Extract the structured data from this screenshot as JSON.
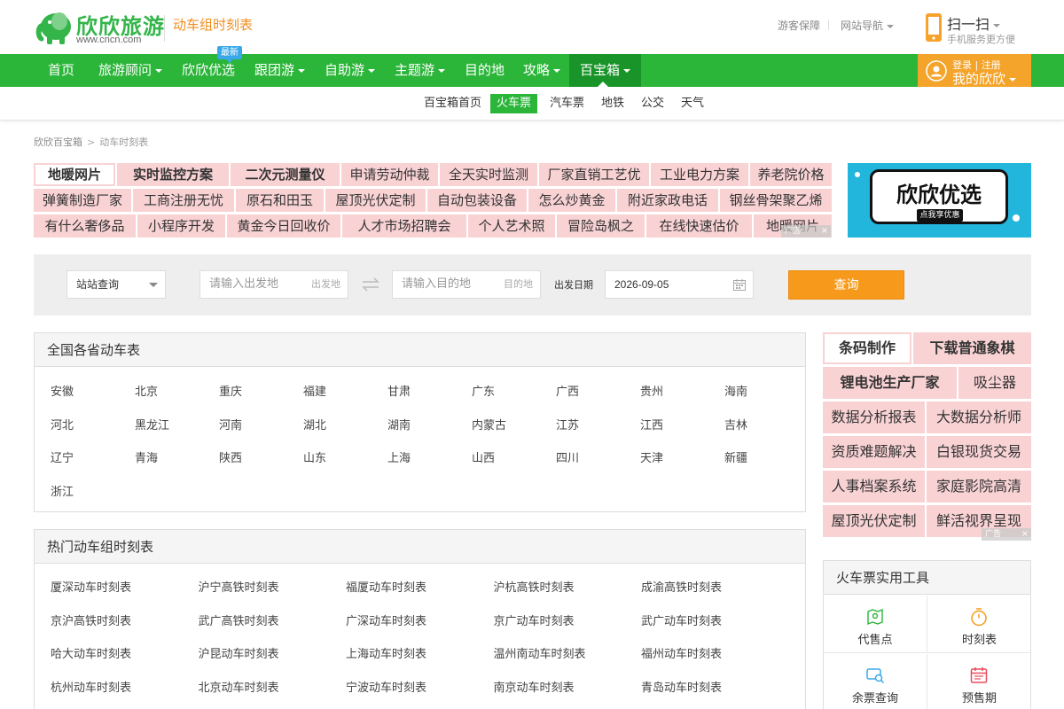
{
  "header": {
    "logo_text": "欣欣旅游",
    "logo_url": "www.cncn.com",
    "page_subtitle": "动车组时刻表",
    "top_links": {
      "guarantee": "游客保障",
      "site_nav": "网站导航"
    },
    "scan": {
      "title": "扫一扫",
      "subtitle": "手机服务更方便"
    }
  },
  "nav": {
    "items": [
      "首页",
      "旅游顾问",
      "欣欣优选",
      "跟团游",
      "自助游",
      "主题游",
      "目的地",
      "攻略",
      "百宝箱"
    ],
    "new_badge": "最新",
    "login": "登录",
    "register": "注册",
    "my_title": "我的欣欣"
  },
  "subnav": {
    "items": [
      "百宝箱首页",
      "火车票",
      "汽车票",
      "地铁",
      "公交",
      "天气"
    ]
  },
  "breadcrumb": {
    "home": "欣欣百宝箱",
    "current": "动车时刻表"
  },
  "ads": {
    "row1": [
      "地暖网片",
      "实时监控方案",
      "二次元测量仪",
      "申请劳动仲裁",
      "全天实时监测",
      "厂家直销工艺优",
      "工业电力方案",
      "养老院价格"
    ],
    "row2": [
      "弹簧制造厂家",
      "工商注册无忧",
      "原石和田玉",
      "屋顶光伏定制",
      "自动包装设备",
      "怎么炒黄金",
      "附近家政电话",
      "钢丝骨架聚乙烯"
    ],
    "row3": [
      "有什么奢侈品",
      "小程序开发",
      "黄金今日回收价",
      "人才市场招聘会",
      "个人艺术照",
      "冒险岛枫之",
      "在线快速估价",
      "地暖网片"
    ],
    "mark": "广告",
    "close": "×"
  },
  "promo": {
    "title": "欣欣优选",
    "subtitle": "点我享优惠"
  },
  "search": {
    "mode": "站站查询",
    "from_placeholder": "请输入出发地",
    "from_hint": "出发地",
    "to_placeholder": "请输入目的地",
    "to_hint": "目的地",
    "date_label": "出发日期",
    "date_value": "2026-09-05",
    "button": "查询"
  },
  "provinces": {
    "title": "全国各省动车表",
    "items": [
      "安徽",
      "北京",
      "重庆",
      "福建",
      "甘肃",
      "广东",
      "广西",
      "贵州",
      "海南",
      "河北",
      "黑龙江",
      "河南",
      "湖北",
      "湖南",
      "内蒙古",
      "江苏",
      "江西",
      "吉林",
      "辽宁",
      "青海",
      "陕西",
      "山东",
      "上海",
      "山西",
      "四川",
      "天津",
      "新疆",
      "浙江"
    ]
  },
  "hot": {
    "title": "热门动车组时刻表",
    "items": [
      "厦深动车时刻表",
      "沪宁高铁时刻表",
      "福厦动车时刻表",
      "沪杭高铁时刻表",
      "成渝高铁时刻表",
      "京沪高铁时刻表",
      "武广高铁时刻表",
      "广深动车时刻表",
      "京广动车时刻表",
      "武广动车时刻表",
      "哈大动车时刻表",
      "沪昆动车时刻表",
      "上海动车时刻表",
      "温州南动车时刻表",
      "福州动车时刻表",
      "杭州动车时刻表",
      "北京动车时刻表",
      "宁波动车时刻表",
      "南京动车时刻表",
      "青岛动车时刻表"
    ]
  },
  "right_ads": {
    "items": [
      "条码制作",
      "下载普通象棋",
      "锂电池生产厂家",
      "吸尘器",
      "数据分析报表",
      "大数据分析师",
      "资质难题解决",
      "白银现货交易",
      "人事档案系统",
      "家庭影院高清",
      "屋顶光伏定制",
      "鲜活视界呈现"
    ]
  },
  "tools": {
    "title": "火车票实用工具",
    "items": [
      "代售点",
      "时刻表",
      "余票查询",
      "预售期"
    ]
  },
  "colors": {
    "green": "#2bb539",
    "orange": "#f79a1b",
    "pink": "#f9d2d4"
  }
}
